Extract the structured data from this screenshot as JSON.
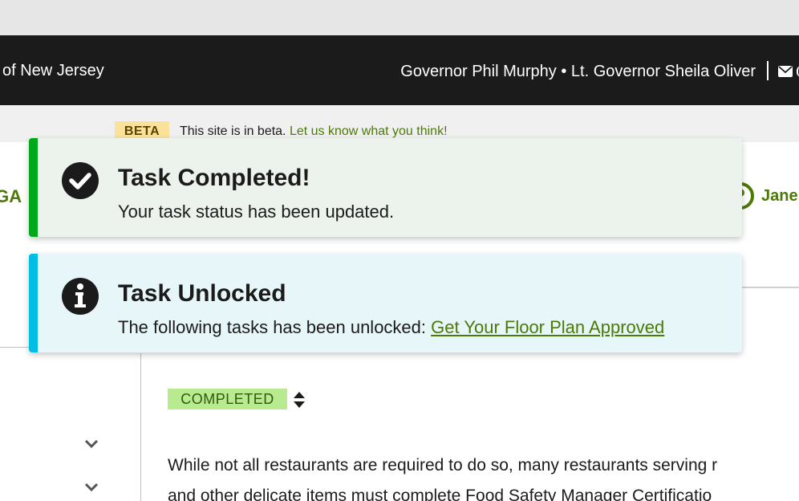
{
  "gov_bar": {
    "state_name": "of New Jersey",
    "officials": "Governor Phil Murphy • Lt. Governor Sheila Oliver",
    "mail_icon": "mail-icon"
  },
  "beta_banner": {
    "badge": "BETA",
    "message": "This site is in beta.",
    "link": "Let us know what you think!"
  },
  "header": {
    "nav_left_fragment": "IGA",
    "user_name": "Jane",
    "user_icon": "user-avatar-icon"
  },
  "toasts": [
    {
      "variant": "success",
      "icon": "check-circle-icon",
      "title": "Task Completed!",
      "body": "Your task status has been updated.",
      "accent": "#00a91c"
    },
    {
      "variant": "info",
      "icon": "info-circle-icon",
      "title": "Task Unlocked",
      "body": "The following tasks has been unlocked:",
      "link": "Get Your Floor Plan Approved",
      "accent": "#00bde3"
    }
  ],
  "task": {
    "status": "COMPLETED",
    "status_color": "#b8eb8f",
    "description_line1": "While not all restaurants are required to do so, many restaurants serving r",
    "description_line2": "and other delicate items must complete Food Safety Manager Certificatio"
  },
  "sidebar": {
    "expand_icons": [
      "chevron-down-icon",
      "chevron-down-icon"
    ]
  }
}
